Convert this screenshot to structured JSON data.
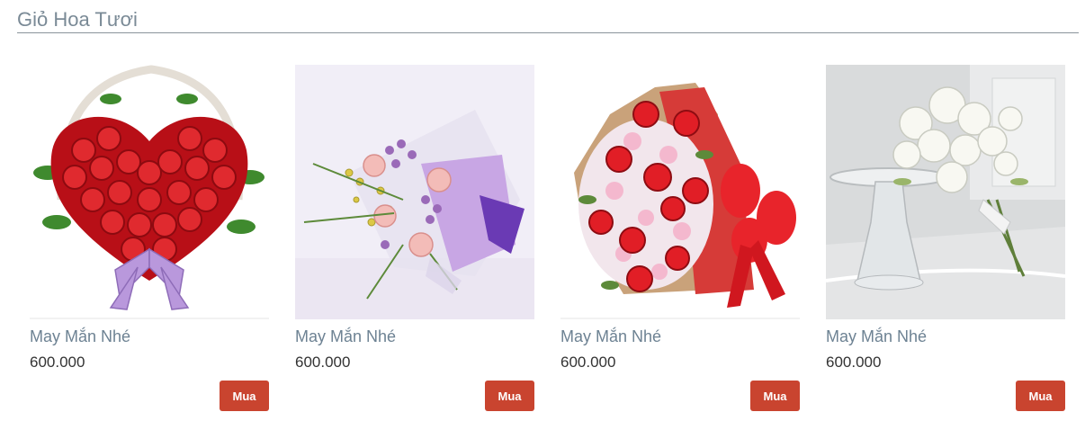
{
  "section": {
    "title": "Giỏ Hoa Tươi"
  },
  "products": [
    {
      "name": "May Mắn Nhé",
      "price": "600.000",
      "buy_label": "Mua"
    },
    {
      "name": "May Mắn Nhé",
      "price": "600.000",
      "buy_label": "Mua"
    },
    {
      "name": "May Mắn Nhé",
      "price": "600.000",
      "buy_label": "Mua"
    },
    {
      "name": "May Mắn Nhé",
      "price": "600.000",
      "buy_label": "Mua"
    }
  ],
  "colors": {
    "buy_button": "#c9442f",
    "title_text": "#7a8a96",
    "product_name": "#6d8293"
  }
}
